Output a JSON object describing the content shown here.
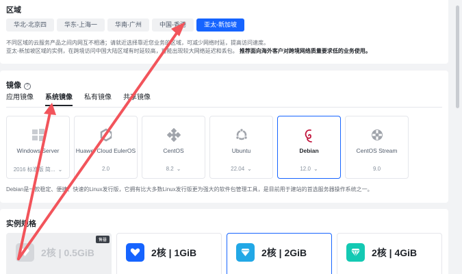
{
  "region": {
    "title": "区域",
    "tabs": [
      "华北-北京四",
      "华东-上海一",
      "华南-广州",
      "中国-香港",
      "亚太-新加坡"
    ],
    "active_tab": 4,
    "desc_line1": "不同区域的云服务产品之间内网互不相通；请就近选择靠近您业务的区域，可减少网络时延，提高访问速度。",
    "desc_line2": "亚太-新加坡区域的实例，在跨境访问中国大陆区域有时延较高，可能出现较大网络延迟和丢包。",
    "desc_line2_bold": "推荐面向海外客户对跨境网络质量要求低的业务使用。"
  },
  "image": {
    "title": "镜像",
    "help": "?",
    "tabs": [
      "应用镜像",
      "系统镜像",
      "私有镜像",
      "共享镜像"
    ],
    "active_tab": 1,
    "os": [
      {
        "name": "Windows Server",
        "version": "2016 标准版 简...",
        "icon": "windows-icon"
      },
      {
        "name": "Huawei Cloud EulerOS",
        "version": "2.0",
        "icon": "huawei-euleros-icon"
      },
      {
        "name": "CentOS",
        "version": "8.2",
        "icon": "centos-icon"
      },
      {
        "name": "Ubuntu",
        "version": "22.04",
        "icon": "ubuntu-icon"
      },
      {
        "name": "Debian",
        "version": "12.0",
        "icon": "debian-icon"
      },
      {
        "name": "CentOS Stream",
        "version": "9.0",
        "icon": "centos-stream-icon"
      }
    ],
    "selected_os": 4,
    "description": "Debian是一款稳定、便捷、快速的Linux发行版，它拥有比大多数Linux发行版更为强大的软件包管理工具，是目前用于建站的首选服务器操作系统之一。"
  },
  "instance": {
    "title": "实例规格",
    "specs": [
      {
        "label": "2核 | 0.5GiB",
        "badge": "售罄",
        "icon_color": "#d5d7db",
        "state": "disabled"
      },
      {
        "label": "2核 | 1GiB",
        "badge": "",
        "icon_color": "#1664ff",
        "state": "normal"
      },
      {
        "label": "2核 | 2GiB",
        "badge": "",
        "icon_color": "#22a8e6",
        "state": "selected"
      },
      {
        "label": "2核 | 4GiB",
        "badge": "",
        "icon_color": "#14c9b3",
        "state": "normal"
      }
    ]
  },
  "colors": {
    "accent": "#1664ff",
    "annotation_arrow": "#f2545b"
  }
}
